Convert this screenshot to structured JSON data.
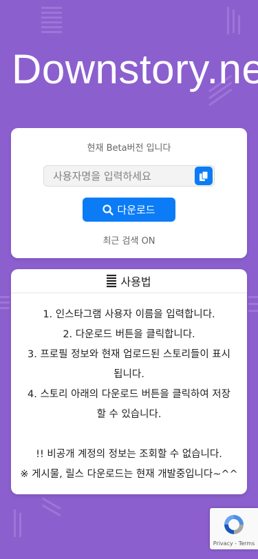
{
  "site": {
    "title": "Downstory.ne"
  },
  "search": {
    "beta_note": "현재 Beta버전 입니다",
    "placeholder": "사용자명을 입력하세요",
    "download_label": "다운로드",
    "recent_search": "최근 검색 ON"
  },
  "usage": {
    "heading": "사용법",
    "steps": [
      "1. 인스타그램 사용자 이름을 입력합니다.",
      "2. 다운로드 버튼을 클릭합니다.",
      "3. 프로필 정보와 현재 업로드된 스토리들이 표시",
      "됩니다.",
      "4. 스토리 아래의 다운로드 버튼을 클릭하여 저장",
      "할 수 있습니다."
    ],
    "notes": [
      "!! 비공개 계정의 정보는 조회할 수 없습니다.",
      "※ 게시물, 릴스 다운로드는 현재 개발중입니다~^^"
    ]
  },
  "recaptcha": {
    "privacy": "Privacy",
    "separator": " - ",
    "terms": "Terms"
  },
  "colors": {
    "background": "#8c5fcf",
    "accent": "#0b7cf6",
    "card": "#ffffff"
  },
  "icons": {
    "paste": "clipboard-icon",
    "download": "search-icon",
    "usage": "list-icon",
    "captcha": "recaptcha-icon"
  }
}
